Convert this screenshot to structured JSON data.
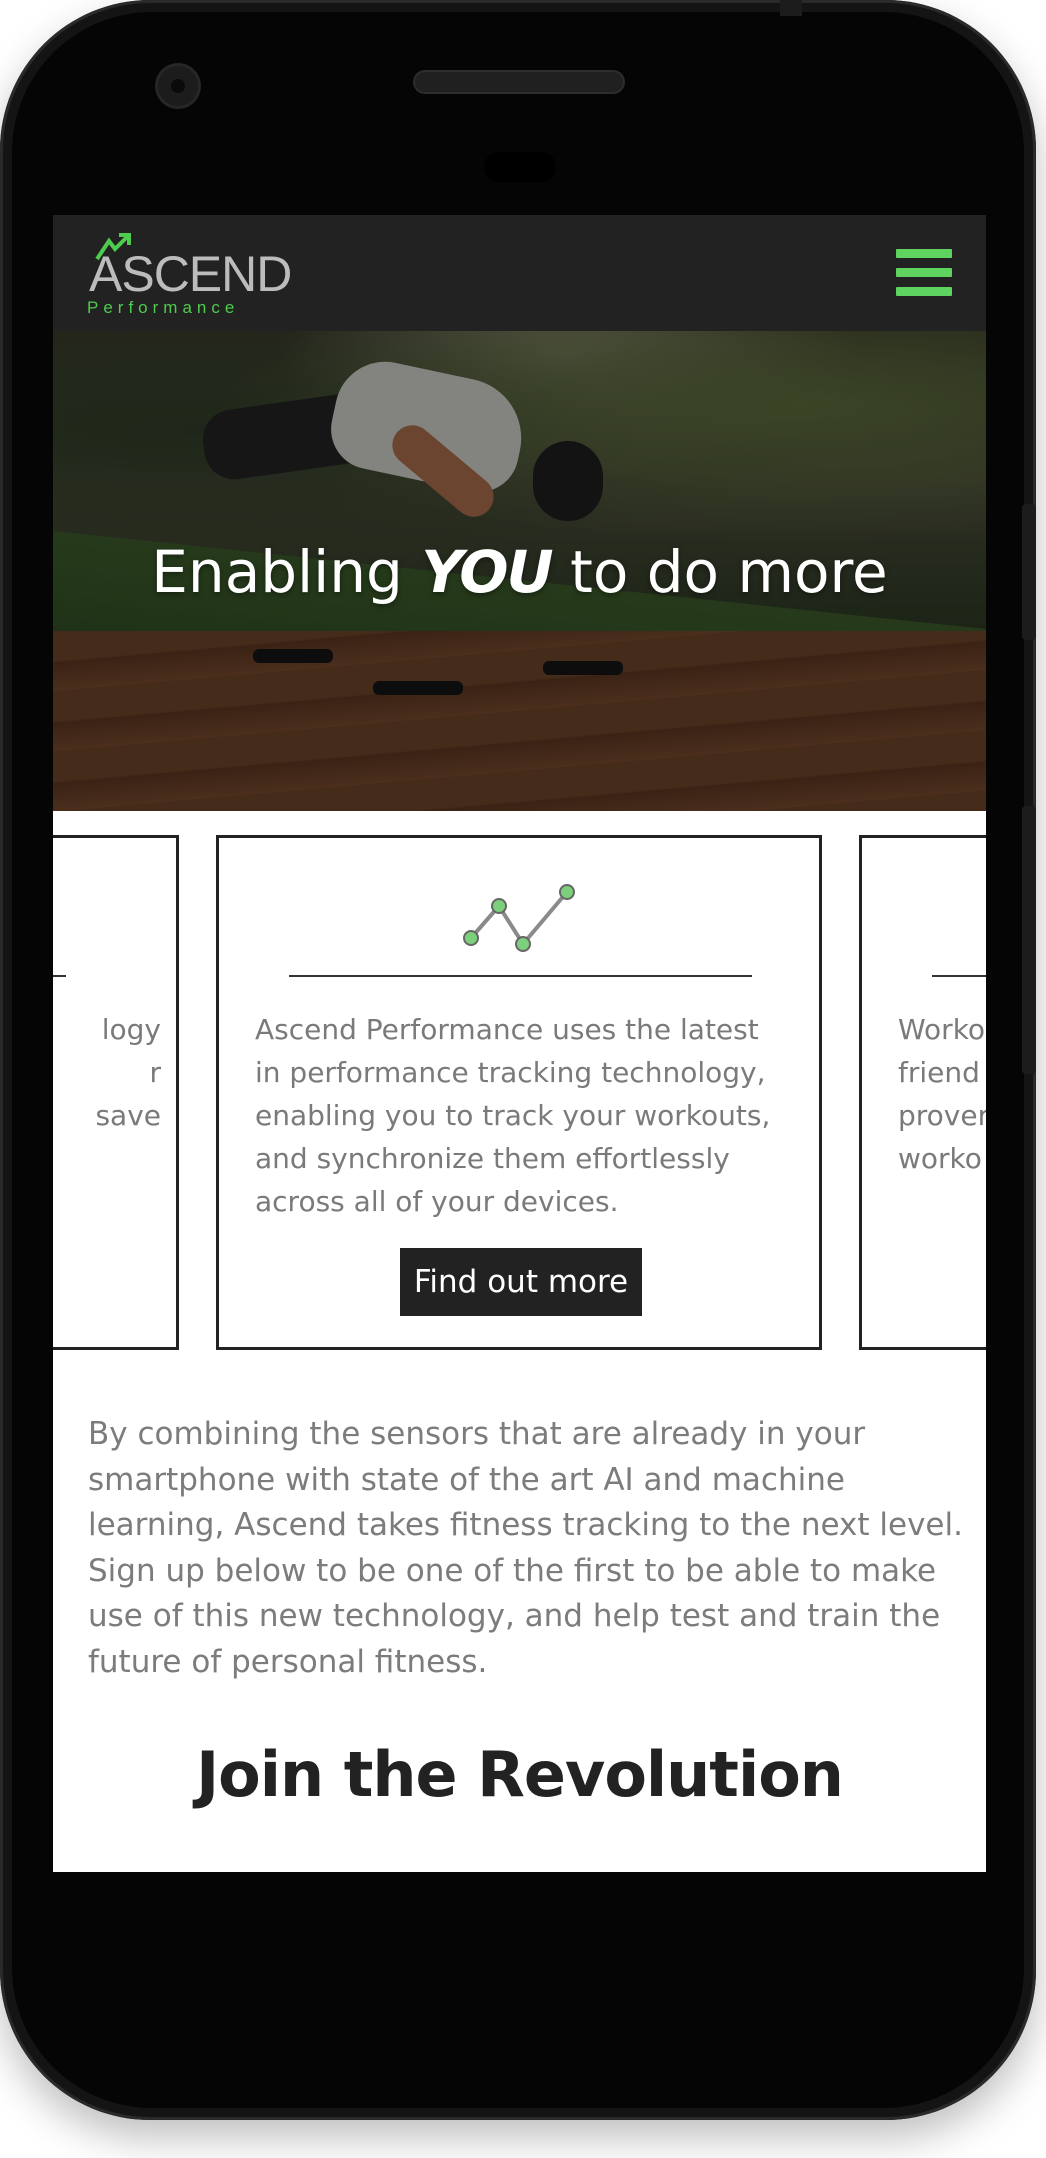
{
  "brand": {
    "name": "ASCEND",
    "tagline": "Performance",
    "accent_color": "#5fd35f"
  },
  "nav": {
    "menu_icon": "hamburger-menu-icon"
  },
  "hero": {
    "title_before": "Enabling ",
    "title_emphasis": "YOU",
    "title_after": " to do more"
  },
  "cards": {
    "left": {
      "lines": [
        "logy",
        "r",
        "save"
      ]
    },
    "center": {
      "icon": "line-chart-icon",
      "lines": [
        "Ascend Performance uses the latest",
        "in performance tracking technology,",
        "enabling you to track your workouts,",
        "and synchronize them effortlessly",
        "across all of your devices."
      ],
      "button_label": "Find out more"
    },
    "right": {
      "lines": [
        "Worko",
        "friend",
        "prover",
        "worko"
      ]
    }
  },
  "intro": {
    "lines": [
      "By combining the sensors that are already in your",
      "smartphone with state of the art AI and machine",
      "learning, Ascend takes fitness tracking to the next level.",
      "Sign up below to be one of the first to be able to make",
      "use of this new technology, and help test and train the",
      "future of personal fitness."
    ]
  },
  "signup": {
    "heading": "Join the Revolution"
  }
}
